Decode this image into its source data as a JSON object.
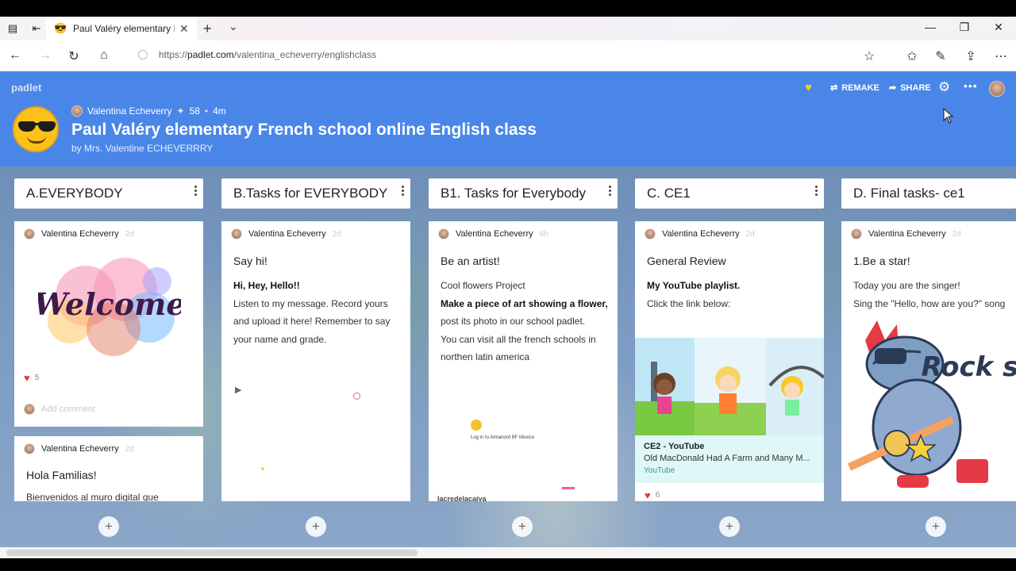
{
  "browser": {
    "tab_title": "Paul Valéry elementary I",
    "tab_favicon": "😎",
    "url_scheme": "https://",
    "url_domain": "padlet.com",
    "url_path": "/valentina_echeverry/englishclass"
  },
  "padlet": {
    "brand": "padlet",
    "author_name": "Valentina Echeverry",
    "likes_symbol": "✦",
    "likes": "58",
    "age": "4m",
    "title": "Paul Valéry elementary French school online English class",
    "byline": "by Mrs. Valentine ECHEVERRRY",
    "actions": {
      "remake": "REMAKE",
      "share": "SHARE"
    },
    "accent_color": "#4a86e8"
  },
  "columns": [
    {
      "title": "A.EVERYBODY",
      "cards": [
        {
          "author": "Valentina Echeverry",
          "ago": "2d",
          "image_text": "Welcome",
          "likes": "5",
          "comment_placeholder": "Add comment"
        },
        {
          "author": "Valentina Echeverry",
          "ago": "2d",
          "title": "Hola Familias!",
          "body": "Bienvenidos al muro digital que"
        }
      ]
    },
    {
      "title": "B.Tasks for EVERYBODY",
      "cards": [
        {
          "author": "Valentina Echeverry",
          "ago": "2d",
          "title": "Say hi!",
          "body_bold": "Hi, Hey, Hello!!",
          "body": "Listen to my message. Record yours and upload it here! Remember to say your name and grade."
        }
      ]
    },
    {
      "title": "B1. Tasks for Everybody",
      "cards": [
        {
          "author": "Valentina Echeverry",
          "ago": "6h",
          "title": "Be an artist!",
          "line1": "Cool flowers Project",
          "bold": "Make a piece of art showing a flower,",
          "after_bold": " post its photo in our school padlet.",
          "line3": "You can visit all the french schools in northen latin america",
          "preview_text": "Log in to Amlanord BF Mexico",
          "cut_text": "lacredelacaiya"
        }
      ]
    },
    {
      "title": "C. CE1",
      "cards": [
        {
          "author": "Valentina Echeverry",
          "ago": "2d",
          "title": "General Review",
          "body_bold": "My YouTube playlist.",
          "body": "Click the link below:",
          "link_title": "CE2 - YouTube",
          "link_desc": "Old MacDonald Had A Farm and Many M...",
          "link_source": "YouTube",
          "likes": "6"
        }
      ]
    },
    {
      "title": "D. Final tasks- ce1",
      "cards": [
        {
          "author": "Valentina Echeverry",
          "ago": "2d",
          "title": "1.Be a star!",
          "line1": "Today you are the singer!",
          "line2": "Sing the \"Hello, how are you?\" song",
          "image_text": "Rock star"
        }
      ]
    }
  ],
  "icons": {
    "back": "arrow-left-icon",
    "forward": "arrow-right-icon",
    "refresh": "refresh-icon",
    "home": "home-icon",
    "favorite": "star-icon",
    "plus": "plus-icon"
  }
}
